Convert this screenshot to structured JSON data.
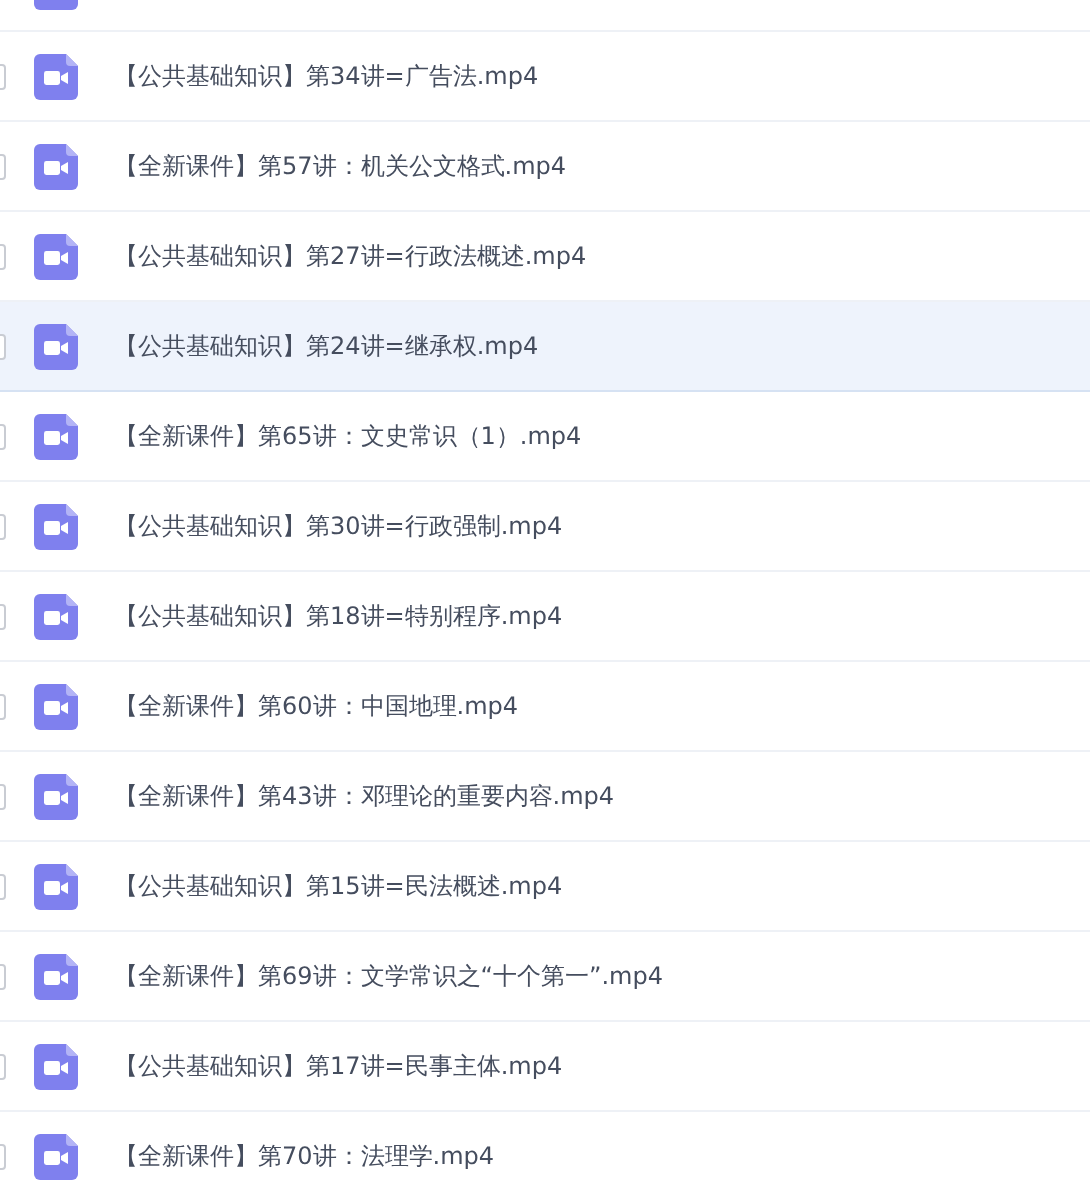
{
  "top_partial_row": {
    "kind": "video"
  },
  "files": [
    {
      "name": "【公共基础知识】第34讲=广告法.mp4",
      "kind": "video",
      "checked": false,
      "selected": false
    },
    {
      "name": "【全新课件】第57讲：机关公文格式.mp4",
      "kind": "video",
      "checked": false,
      "selected": false
    },
    {
      "name": "【公共基础知识】第27讲=行政法概述.mp4",
      "kind": "video",
      "checked": false,
      "selected": false
    },
    {
      "name": "【公共基础知识】第24讲=继承权.mp4",
      "kind": "video",
      "checked": false,
      "selected": true
    },
    {
      "name": "【全新课件】第65讲：文史常识（1）.mp4",
      "kind": "video",
      "checked": false,
      "selected": false
    },
    {
      "name": "【公共基础知识】第30讲=行政强制.mp4",
      "kind": "video",
      "checked": false,
      "selected": false
    },
    {
      "name": "【公共基础知识】第18讲=特别程序.mp4",
      "kind": "video",
      "checked": false,
      "selected": false
    },
    {
      "name": "【全新课件】第60讲：中国地理.mp4",
      "kind": "video",
      "checked": false,
      "selected": false
    },
    {
      "name": "【全新课件】第43讲：邓理论的重要内容.mp4",
      "kind": "video",
      "checked": false,
      "selected": false
    },
    {
      "name": "【公共基础知识】第15讲=民法概述.mp4",
      "kind": "video",
      "checked": false,
      "selected": false
    },
    {
      "name": "【全新课件】第69讲：文学常识之“十个第一”.mp4",
      "kind": "video",
      "checked": false,
      "selected": false
    },
    {
      "name": "【公共基础知识】第17讲=民事主体.mp4",
      "kind": "video",
      "checked": false,
      "selected": false
    },
    {
      "name": "【全新课件】第70讲：法理学.mp4",
      "kind": "video",
      "checked": false,
      "selected": false
    }
  ]
}
